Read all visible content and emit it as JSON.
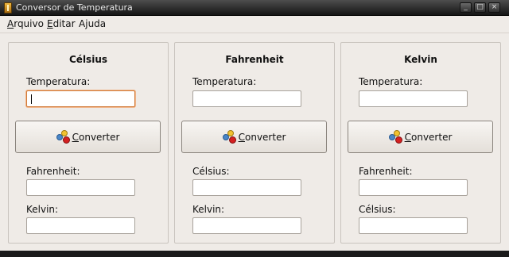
{
  "window": {
    "title": "Conversor de Temperatura",
    "controls": [
      "_",
      "□",
      "×"
    ]
  },
  "menu": [
    {
      "pre": "",
      "u": "A",
      "post": "rquivo"
    },
    {
      "pre": "",
      "u": "E",
      "post": "ditar"
    },
    {
      "pre": "A",
      "u": "j",
      "post": "uda"
    }
  ],
  "panels": [
    {
      "title": "Célsius",
      "input_label": "Temperatura:",
      "input_value": "",
      "button": {
        "u": "C",
        "rest": "onverter"
      },
      "out1_label": "Fahrenheit:",
      "out1_value": "",
      "out2_label": "Kelvin:",
      "out2_value": ""
    },
    {
      "title": "Fahrenheit",
      "input_label": "Temperatura:",
      "input_value": "",
      "button": {
        "u": "C",
        "rest": "onverter"
      },
      "out1_label": "Célsius:",
      "out1_value": "",
      "out2_label": "Kelvin:",
      "out2_value": ""
    },
    {
      "title": "Kelvin",
      "input_label": "Temperatura:",
      "input_value": "",
      "button": {
        "u": "C",
        "rest": "onverter"
      },
      "out1_label": "Fahrenheit:",
      "out1_value": "",
      "out2_label": "Célsius:",
      "out2_value": ""
    }
  ],
  "colors": {
    "focus_border": "#d17b3a",
    "window_bg": "#efebe7"
  }
}
